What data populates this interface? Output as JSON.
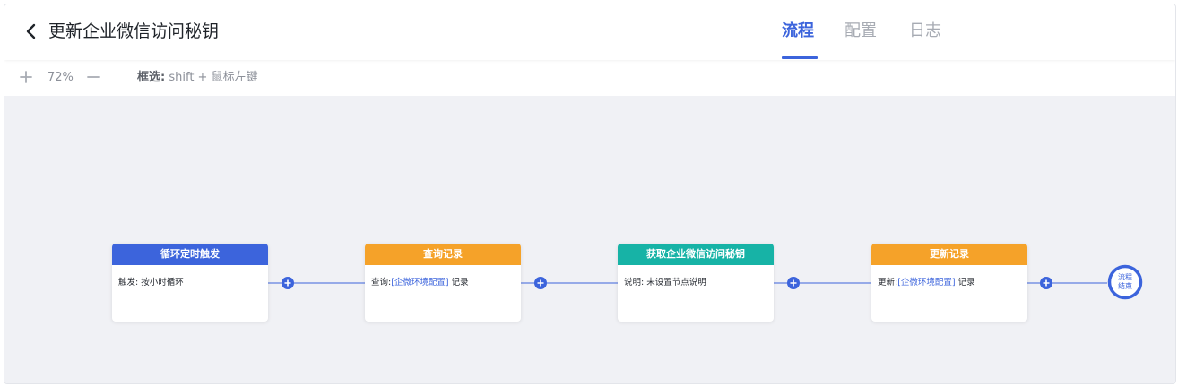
{
  "header": {
    "title": "更新企业微信访问秘钥",
    "tabs": [
      {
        "label": "流程",
        "active": true
      },
      {
        "label": "配置",
        "active": false
      },
      {
        "label": "日志",
        "active": false
      }
    ]
  },
  "toolbar": {
    "zoom_level": "72%",
    "hint_label": "框选:",
    "hint_text": "shift + 鼠标左键"
  },
  "flow": {
    "nodes": [
      {
        "title": "循环定时触发",
        "color": "#3c64dc",
        "prefix": "触发:",
        "text": "按小时循环",
        "tag": "",
        "suffix": ""
      },
      {
        "title": "查询记录",
        "color": "#f5a229",
        "prefix": "查询:",
        "text": "",
        "tag": "[企微环境配置]",
        "suffix": "记录"
      },
      {
        "title": "获取企业微信访问秘钥",
        "color": "#17b3a6",
        "prefix": "说明:",
        "text": "未设置节点说明",
        "tag": "",
        "suffix": ""
      },
      {
        "title": "更新记录",
        "color": "#f5a229",
        "prefix": "更新:",
        "text": "",
        "tag": "[企微环境配置]",
        "suffix": "记录"
      }
    ],
    "end_label_line1": "流程",
    "end_label_line2": "结束"
  },
  "colors": {
    "accent": "#3c64dc",
    "trigger": "#3c64dc",
    "query": "#f5a229",
    "action": "#17b3a6",
    "update": "#f5a229"
  },
  "icons": {
    "back": "chevron-left-icon",
    "zoom_in": "plus-icon",
    "zoom_out": "minus-icon",
    "add": "plus-circle-icon"
  }
}
